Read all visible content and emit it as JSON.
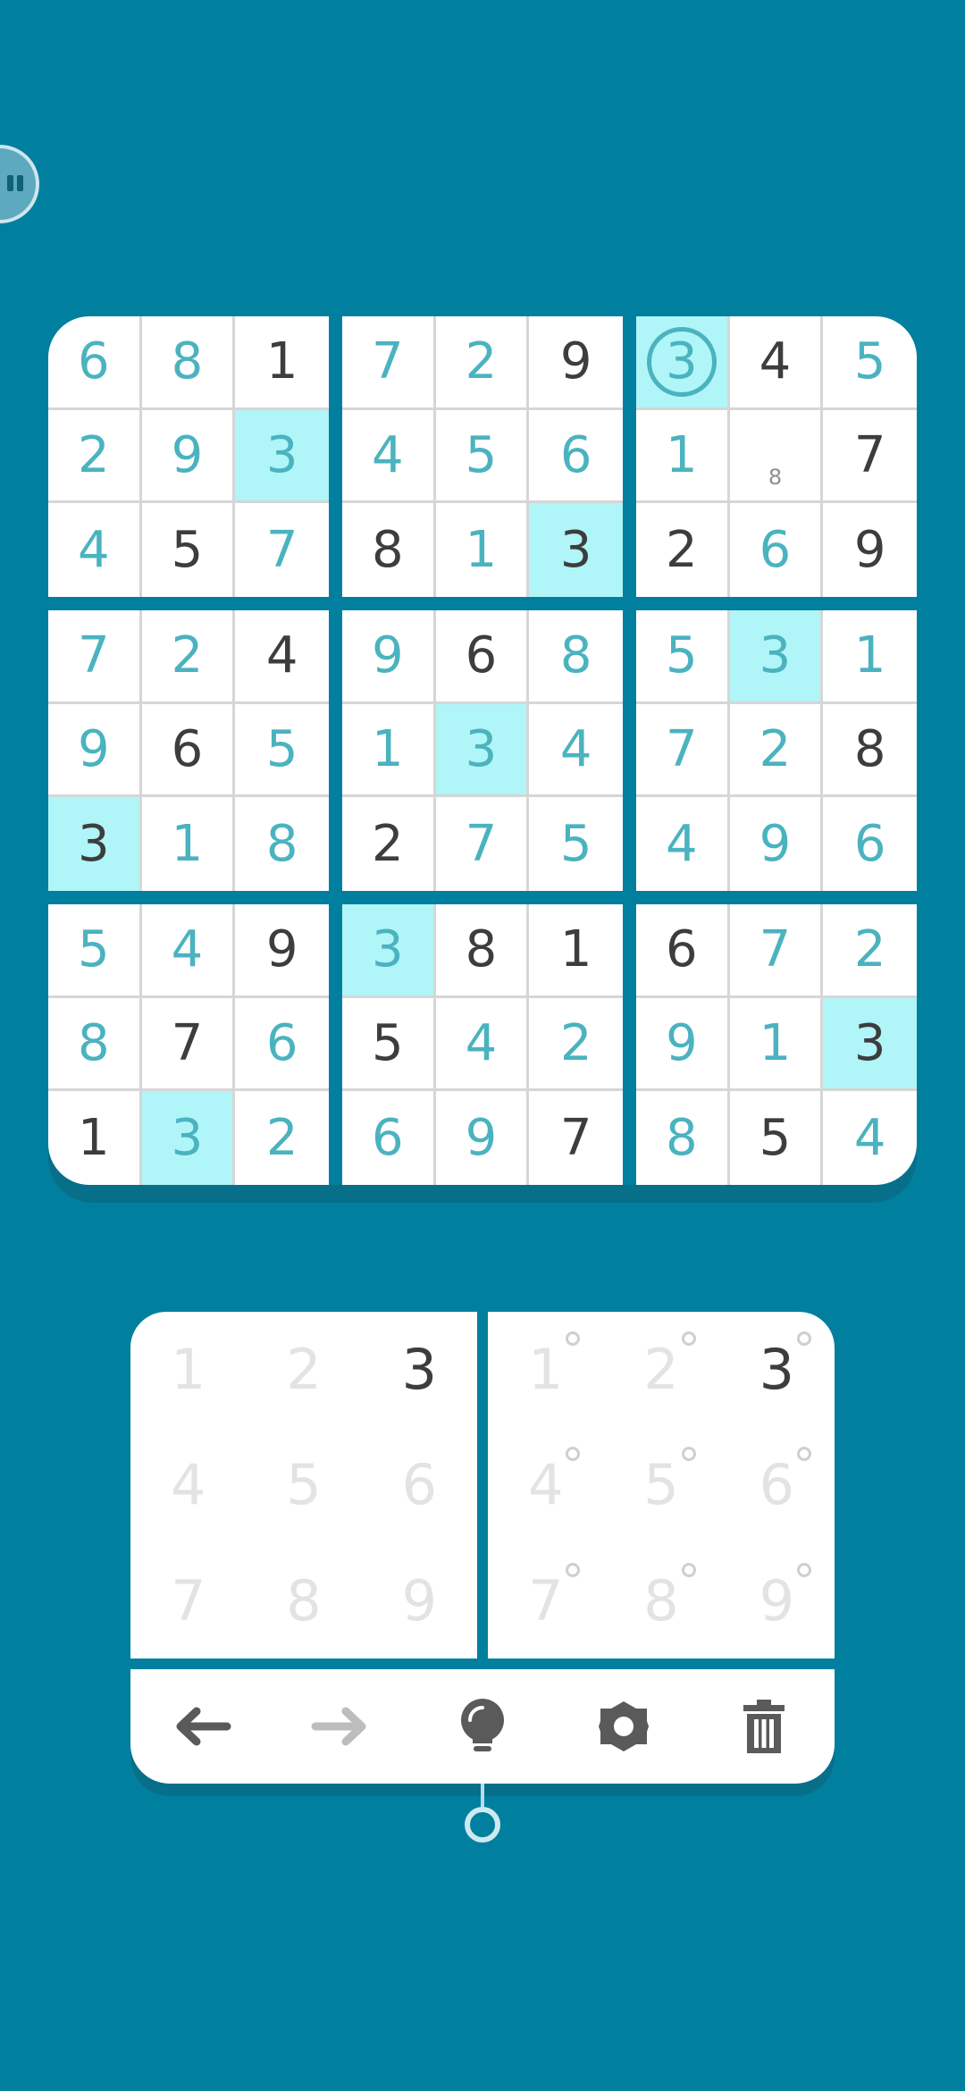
{
  "board": {
    "rows": [
      [
        "6",
        "8",
        "1",
        "7",
        "2",
        "9",
        "3",
        "4",
        "5"
      ],
      [
        "2",
        "9",
        "3",
        "4",
        "5",
        "6",
        "1",
        "",
        "7"
      ],
      [
        "4",
        "5",
        "7",
        "8",
        "1",
        "3",
        "2",
        "6",
        "9"
      ],
      [
        "7",
        "2",
        "4",
        "9",
        "6",
        "8",
        "5",
        "3",
        "1"
      ],
      [
        "9",
        "6",
        "5",
        "1",
        "3",
        "4",
        "7",
        "2",
        "8"
      ],
      [
        "3",
        "1",
        "8",
        "2",
        "7",
        "5",
        "4",
        "9",
        "6"
      ],
      [
        "5",
        "4",
        "9",
        "3",
        "8",
        "1",
        "6",
        "7",
        "2"
      ],
      [
        "8",
        "7",
        "6",
        "5",
        "4",
        "2",
        "9",
        "1",
        "3"
      ],
      [
        "1",
        "3",
        "2",
        "6",
        "9",
        "7",
        "8",
        "5",
        "4"
      ]
    ],
    "given": [
      [
        0,
        0,
        1,
        0,
        0,
        1,
        0,
        1,
        0
      ],
      [
        0,
        0,
        0,
        0,
        0,
        0,
        0,
        0,
        1
      ],
      [
        0,
        1,
        0,
        1,
        0,
        1,
        1,
        0,
        1
      ],
      [
        0,
        0,
        1,
        0,
        1,
        0,
        0,
        0,
        0
      ],
      [
        0,
        1,
        0,
        0,
        0,
        0,
        0,
        0,
        1
      ],
      [
        1,
        0,
        0,
        1,
        0,
        0,
        0,
        0,
        0
      ],
      [
        0,
        0,
        1,
        0,
        1,
        1,
        1,
        0,
        0
      ],
      [
        0,
        1,
        0,
        1,
        0,
        0,
        0,
        0,
        1
      ],
      [
        1,
        0,
        0,
        0,
        0,
        1,
        0,
        1,
        0
      ]
    ],
    "highlighted": [
      [
        0,
        6
      ],
      [
        1,
        2
      ],
      [
        2,
        5
      ],
      [
        3,
        7
      ],
      [
        4,
        4
      ],
      [
        5,
        0
      ],
      [
        6,
        3
      ],
      [
        7,
        8
      ],
      [
        8,
        1
      ]
    ],
    "selected": [
      0,
      6
    ],
    "notes": {
      "1-7": "8"
    },
    "colors": {
      "given": "#3d3d3d",
      "user": "#4ab3bf",
      "highlight": "#b0f5f7",
      "background": "#017f9f"
    }
  },
  "number_pad": {
    "keys": [
      "1",
      "2",
      "3",
      "4",
      "5",
      "6",
      "7",
      "8",
      "9"
    ],
    "active": "3"
  },
  "note_pad": {
    "keys": [
      "1",
      "2",
      "3",
      "4",
      "5",
      "6",
      "7",
      "8",
      "9"
    ],
    "active": "3"
  },
  "toolbar": {
    "icons": [
      "undo-arrow-icon",
      "redo-arrow-icon",
      "hint-bulb-icon",
      "settings-gear-icon",
      "delete-trash-icon"
    ]
  }
}
